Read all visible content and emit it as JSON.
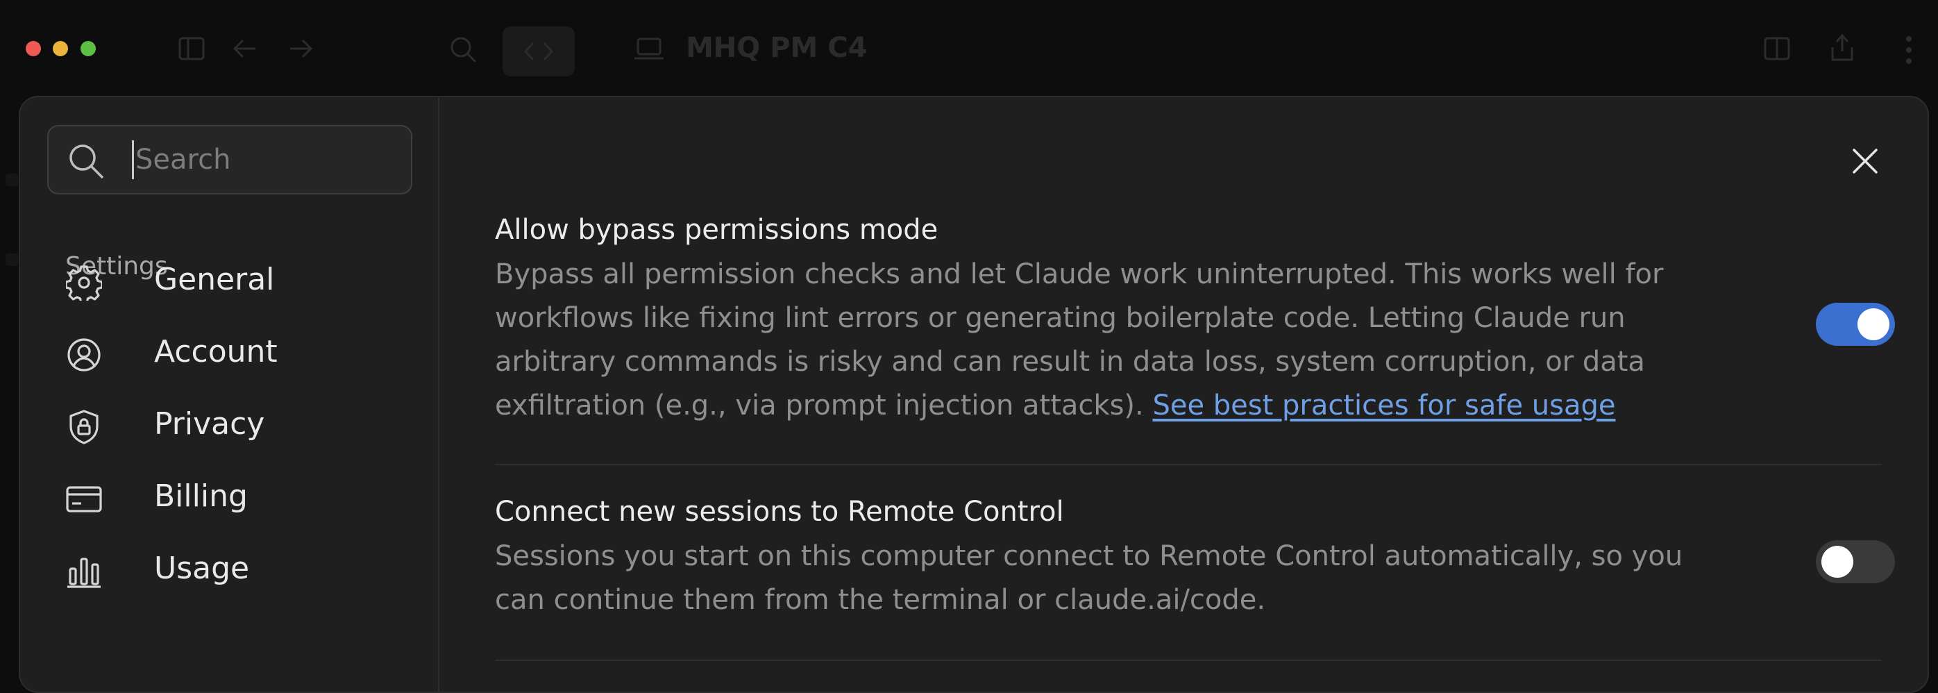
{
  "titlebar": {
    "title": "MHQ PM C4"
  },
  "search": {
    "placeholder": "Search"
  },
  "sidebar": {
    "heading": "Settings",
    "items": [
      {
        "label": "General",
        "icon": "gear-icon"
      },
      {
        "label": "Account",
        "icon": "user-circle-icon"
      },
      {
        "label": "Privacy",
        "icon": "shield-lock-icon"
      },
      {
        "label": "Billing",
        "icon": "credit-card-icon"
      },
      {
        "label": "Usage",
        "icon": "bar-chart-icon"
      }
    ]
  },
  "settings": [
    {
      "title": "Allow bypass permissions mode",
      "description": "Bypass all permission checks and let Claude work uninterrupted. This works well for workflows like fixing lint errors or generating boilerplate code. Letting Claude run arbitrary commands is risky and can result in data loss, system corruption, or data exfiltration (e.g., via prompt injection attacks).",
      "link_text": "See best practices for safe usage",
      "enabled": true
    },
    {
      "title": "Connect new sessions to Remote Control",
      "description": "Sessions you start on this computer connect to Remote Control automatically, so you can continue them from the terminal or claude.ai/code.",
      "enabled": false
    }
  ],
  "colors": {
    "accent": "#3b6fd0",
    "link": "#6f9fe4",
    "modal_bg": "#1f1f1f",
    "toggle_off": "#3a3a3a"
  }
}
